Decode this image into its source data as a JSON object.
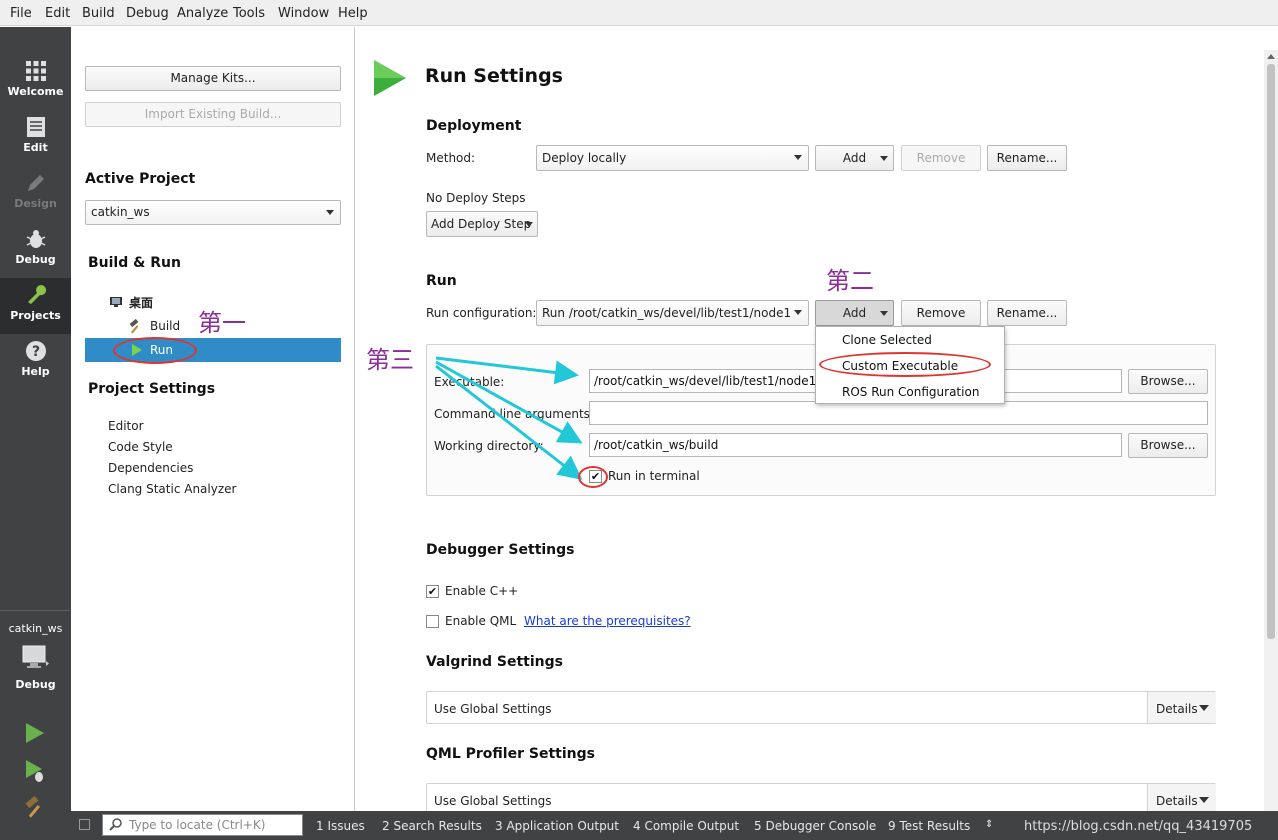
{
  "menu": [
    "File",
    "Edit",
    "Build",
    "Debug",
    "Analyze",
    "Tools",
    "Window",
    "Help"
  ],
  "modes": [
    {
      "label": "Welcome",
      "icon": "grid-icon"
    },
    {
      "label": "Edit",
      "icon": "document-icon"
    },
    {
      "label": "Design",
      "icon": "pencil-icon"
    },
    {
      "label": "Debug",
      "icon": "bug-icon"
    },
    {
      "label": "Projects",
      "icon": "wrench-icon"
    },
    {
      "label": "Help",
      "icon": "help-icon"
    }
  ],
  "kit": {
    "project": "catkin_ws",
    "mode": "Debug"
  },
  "projects": {
    "manage_kits": "Manage Kits...",
    "import_build": "Import Existing Build...",
    "active_project_heading": "Active Project",
    "active_project": "catkin_ws",
    "build_run_heading": "Build & Run",
    "kit_name": "桌面",
    "build_item": "Build",
    "run_item": "Run",
    "project_settings_heading": "Project Settings",
    "settings_items": [
      "Editor",
      "Code Style",
      "Dependencies",
      "Clang Static Analyzer"
    ]
  },
  "run_settings": {
    "title": "Run Settings",
    "deployment_heading": "Deployment",
    "method_label": "Method:",
    "method_value": "Deploy locally",
    "add": "Add",
    "remove": "Remove",
    "rename": "Rename...",
    "no_deploy_steps": "No Deploy Steps",
    "add_deploy_step": "Add Deploy Step",
    "run_heading": "Run",
    "run_config_label": "Run configuration:",
    "run_config_value": "Run /root/catkin_ws/devel/lib/test1/node1",
    "executable_label": "Executable:",
    "executable_value": "/root/catkin_ws/devel/lib/test1/node1",
    "args_label": "Command line arguments:",
    "args_value": "",
    "workdir_label": "Working directory:",
    "workdir_value": "/root/catkin_ws/build",
    "browse": "Browse...",
    "run_in_terminal": "Run in terminal",
    "debugger_heading": "Debugger Settings",
    "enable_cpp": "Enable C++",
    "enable_qml": "Enable QML",
    "prereq_link": "What are the prerequisites?",
    "valgrind_heading": "Valgrind Settings",
    "use_global": "Use Global Settings",
    "details": "Details",
    "qml_profiler_heading": "QML Profiler Settings"
  },
  "add_menu": [
    "Clone Selected",
    "Custom Executable",
    "ROS Run Configuration"
  ],
  "annotations": {
    "first": "第一",
    "second": "第二",
    "third": "第三"
  },
  "statusbar": {
    "locate_placeholder": "Type to locate (Ctrl+K)",
    "tabs": [
      "1  Issues",
      "2  Search Results",
      "3  Application Output",
      "4  Compile Output",
      "5  Debugger Console",
      "9  Test Results"
    ],
    "watermark": "https://blog.csdn.net/qq_43419705"
  },
  "colors": {
    "selection": "#308cc6",
    "mode_bar": "#404244",
    "annotation_arrow": "#22c7d8",
    "annotation_ring": "#e0342f",
    "annotation_text": "#8b2d9a"
  }
}
